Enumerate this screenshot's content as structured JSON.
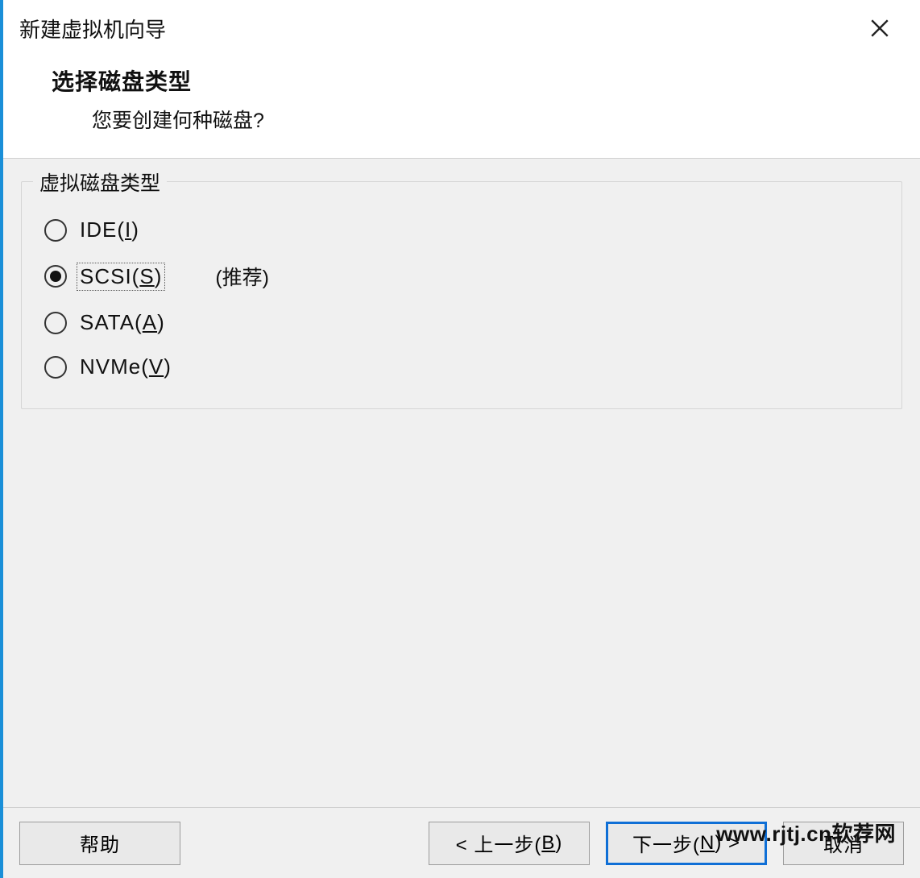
{
  "window": {
    "title": "新建虚拟机向导"
  },
  "header": {
    "title": "选择磁盘类型",
    "subtitle": "您要创建何种磁盘?"
  },
  "group": {
    "legend": "虚拟磁盘类型",
    "options": [
      {
        "label_pre": "IDE(",
        "mn": "I",
        "label_post": ")",
        "checked": false,
        "suffix": ""
      },
      {
        "label_pre": "SCSI(",
        "mn": "S",
        "label_post": ")",
        "checked": true,
        "suffix": "(推荐)",
        "focused": true
      },
      {
        "label_pre": "SATA(",
        "mn": "A",
        "label_post": ")",
        "checked": false,
        "suffix": ""
      },
      {
        "label_pre": "NVMe(",
        "mn": "V",
        "label_post": ")",
        "checked": false,
        "suffix": ""
      }
    ]
  },
  "footer": {
    "help": "帮助",
    "back_pre": "< 上一步(",
    "back_mn": "B",
    "back_post": ")",
    "next_pre": "下一步(",
    "next_mn": "N",
    "next_post": ") >",
    "cancel": "取消"
  },
  "watermark": "www.rjtj.cn软荐网"
}
